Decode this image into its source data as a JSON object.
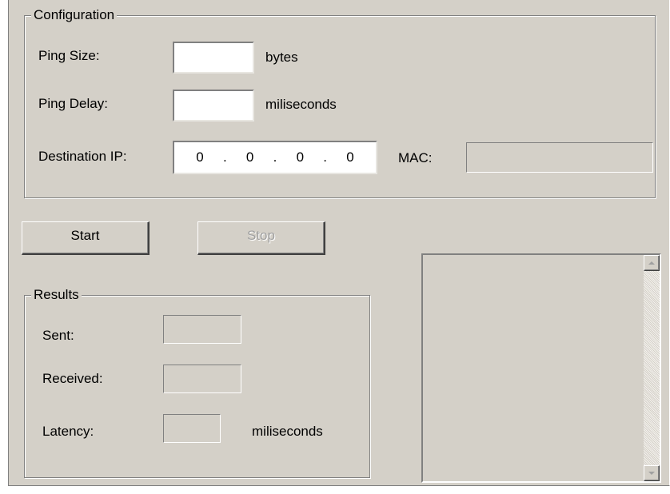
{
  "configuration": {
    "legend": "Configuration",
    "ping_size_label": "Ping Size:",
    "ping_size_value": "",
    "ping_size_unit": "bytes",
    "ping_delay_label": "Ping Delay:",
    "ping_delay_value": "",
    "ping_delay_unit": "miliseconds",
    "dest_ip_label": "Destination IP:",
    "dest_ip_octets": [
      "0",
      "0",
      "0",
      "0"
    ],
    "ip_separator": ".",
    "mac_label": "MAC:",
    "mac_value": ""
  },
  "buttons": {
    "start_label": "Start",
    "stop_label": "Stop",
    "stop_enabled": false
  },
  "results": {
    "legend": "Results",
    "sent_label": "Sent:",
    "sent_value": "",
    "received_label": "Received:",
    "received_value": "",
    "latency_label": "Latency:",
    "latency_value": "",
    "latency_unit": "miliseconds"
  },
  "log_list": {
    "items": [],
    "scrollbar": {
      "up_icon": "scroll-up-arrow-icon",
      "down_icon": "scroll-down-arrow-icon"
    }
  },
  "colors": {
    "dialog_bg": "#d4d0c8",
    "disabled_text": "#a0a0a0"
  }
}
